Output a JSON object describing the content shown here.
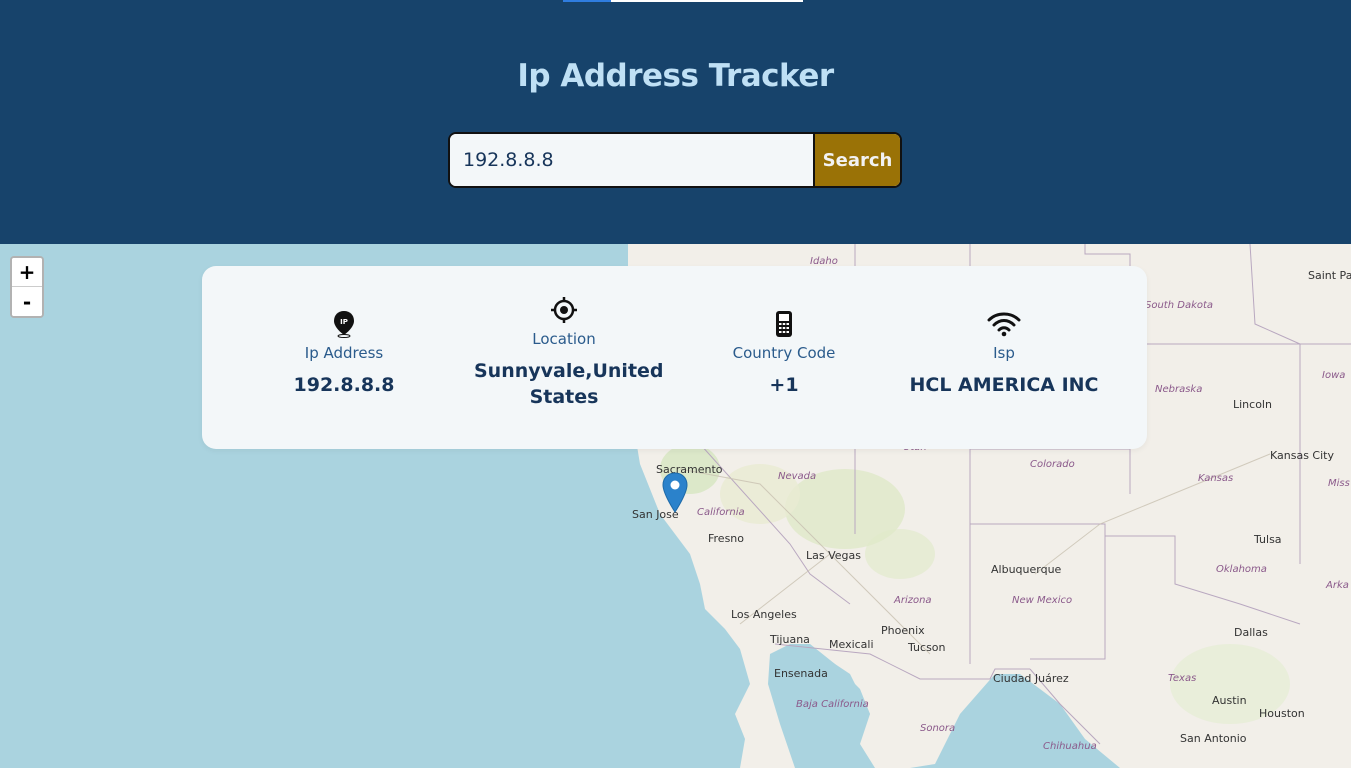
{
  "header": {
    "title": "Ip Address Tracker",
    "search": {
      "value": "192.8.8.8",
      "placeholder": "",
      "button_label": "Search"
    }
  },
  "colors": {
    "header_bg": "#17436b",
    "title": "#bfe0f5",
    "search_button": "#9a7206",
    "card_bg": "#f3f7f9",
    "text_dark": "#17355a",
    "label": "#2a5b8c",
    "sea": "#aad3df",
    "land": "#f2efe9",
    "marker": "#2b82cb"
  },
  "info": {
    "ip": {
      "icon": "ip-pin-icon",
      "label": "Ip Address",
      "value": "192.8.8.8"
    },
    "location": {
      "icon": "crosshair-icon",
      "label": "Location",
      "value_line1": "Sunnyvale,United",
      "value_line2": "States"
    },
    "country_code": {
      "icon": "phone-icon",
      "label": "Country Code",
      "value": "+1"
    },
    "isp": {
      "icon": "wifi-icon",
      "label": "Isp",
      "value": "HCL AMERICA INC"
    }
  },
  "map": {
    "zoom_in": "+",
    "zoom_out": "-",
    "cities": [
      "Sacramento",
      "San Jose",
      "Fresno",
      "Las Vegas",
      "Los Angeles",
      "Tijuana",
      "Mexicali",
      "Ensenada",
      "Phoenix",
      "Tucson",
      "Albuquerque",
      "Ciudad Juárez",
      "Tulsa",
      "Dallas",
      "Austin",
      "Houston",
      "San Antonio",
      "Kansas City",
      "Lincoln",
      "Saint Pa"
    ],
    "states": [
      "Idaho",
      "South Dakota",
      "Nebraska",
      "Iowa",
      "Utah",
      "Colorado",
      "Kansas",
      "Miss",
      "Nevada",
      "California",
      "Arizona",
      "New Mexico",
      "Oklahoma",
      "Arka",
      "Texas",
      "Baja California",
      "Sonora",
      "Chihuahua"
    ],
    "marker_icon": "map-marker-icon"
  }
}
